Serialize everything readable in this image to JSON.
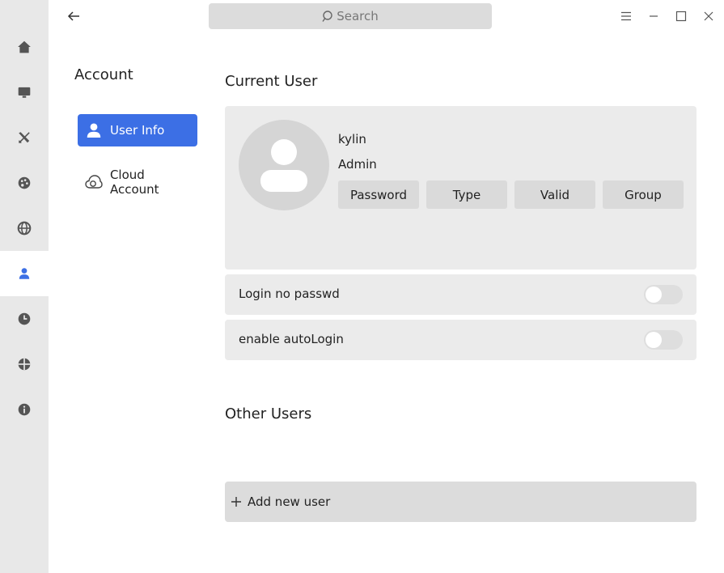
{
  "search": {
    "placeholder": "Search"
  },
  "sidebar": {
    "items": [
      {
        "icon": "home-icon"
      },
      {
        "icon": "display-icon"
      },
      {
        "icon": "tools-icon"
      },
      {
        "icon": "palette-icon"
      },
      {
        "icon": "globe-icon"
      },
      {
        "icon": "user-icon",
        "active": true
      },
      {
        "icon": "clock-icon"
      },
      {
        "icon": "update-icon"
      },
      {
        "icon": "info-icon"
      }
    ]
  },
  "account": {
    "title": "Account",
    "nav": [
      {
        "label": "User Info",
        "icon": "user-icon",
        "active": true
      },
      {
        "label": "Cloud Account",
        "icon": "cloud-icon"
      }
    ]
  },
  "current_user": {
    "section_title": "Current User",
    "name": "kylin",
    "role": "Admin",
    "buttons": [
      "Password",
      "Type",
      "Valid",
      "Group"
    ]
  },
  "options": {
    "login_no_passwd": "Login no passwd",
    "enable_autologin": "enable autoLogin"
  },
  "other_users": {
    "section_title": "Other Users",
    "add_label": "Add new user"
  },
  "colors": {
    "accent": "#3c6fe5",
    "panel": "#ebebeb",
    "rail": "#e8e8e8"
  }
}
